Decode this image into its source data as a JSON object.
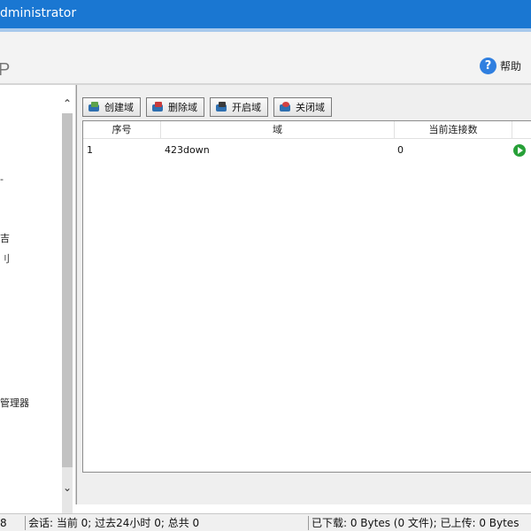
{
  "window": {
    "title": "dministrator"
  },
  "header": {
    "brand": "P",
    "help_label": "帮助"
  },
  "sidebar": {
    "items": [
      {
        "label": "-"
      },
      {
        "label": "吉"
      },
      {
        "label": "刂"
      },
      {
        "label": "管理器"
      }
    ]
  },
  "toolbar": {
    "create_label": "创建域",
    "delete_label": "删除域",
    "start_label": "开启域",
    "close_label": "关闭域"
  },
  "table": {
    "columns": [
      "序号",
      "域",
      "当前连接数"
    ],
    "rows": [
      {
        "index": "1",
        "domain": "423down",
        "connections": "0"
      }
    ]
  },
  "status": {
    "left": "8",
    "sessions": "会话: 当前 0;  过去24小时 0;  总共 0",
    "transfer": "已下载: 0 Bytes (0 文件);  已上传: 0 Bytes"
  }
}
